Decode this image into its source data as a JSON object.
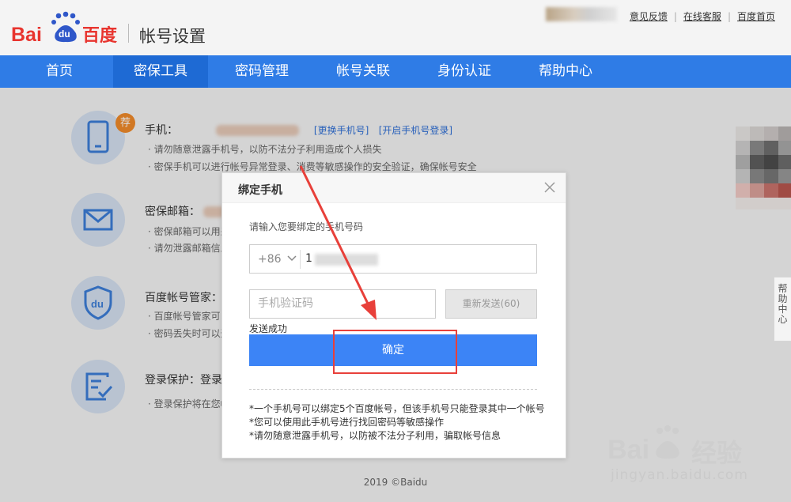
{
  "header": {
    "logo_text": "百度",
    "page_title": "帐号设置",
    "links": [
      "意见反馈",
      "在线客服",
      "百度首页"
    ]
  },
  "nav": {
    "items": [
      "首页",
      "密保工具",
      "密码管理",
      "帐号关联",
      "身份认证",
      "帮助中心"
    ],
    "active": "密保工具"
  },
  "sections": {
    "phone": {
      "badge": "荐",
      "title": "手机：",
      "links": [
        "[更换手机号]",
        "[开启手机号登录]"
      ],
      "desc": [
        "· 请勿随意泄露手机号，以防不法分子利用造成个人损失",
        "· 密保手机可以进行帐号异常登录、消费等敏感操作的安全验证，确保帐号安全"
      ]
    },
    "email": {
      "title": "密保邮箱：",
      "desc": [
        "· 密保邮箱可以用来",
        "· 请勿泄露邮箱信息"
      ]
    },
    "manager": {
      "title": "百度帐号管家：",
      "desc": [
        "· 百度帐号管家可以",
        "· 密码丢失时可以通"
      ]
    },
    "login": {
      "title": "登录保护：登录",
      "desc": [
        "· 登录保护将在您帐"
      ]
    }
  },
  "modal": {
    "title": "绑定手机",
    "prompt": "请输入您要绑定的手机号码",
    "country_code": "+86",
    "phone_prefix": "1",
    "code_placeholder": "手机验证码",
    "resend_label": "重新发送(60)",
    "status": "发送成功",
    "confirm_label": "确定",
    "notes": [
      "*一个手机号可以绑定5个百度帐号，但该手机号只能登录其中一个帐号",
      "*您可以使用此手机号进行找回密码等敏感操作",
      "*请勿随意泄露手机号，以防被不法分子利用，骗取帐号信息"
    ]
  },
  "help_tab": "帮助中心",
  "copyright": "2019 ©Baidu",
  "watermark": {
    "brand": "经验",
    "url": "jingyan.baidu.com"
  },
  "colors": {
    "nav": "#2f7ce6",
    "primary_button": "#3c84f6",
    "highlight": "#e8403a",
    "badge": "#f08a2a"
  }
}
